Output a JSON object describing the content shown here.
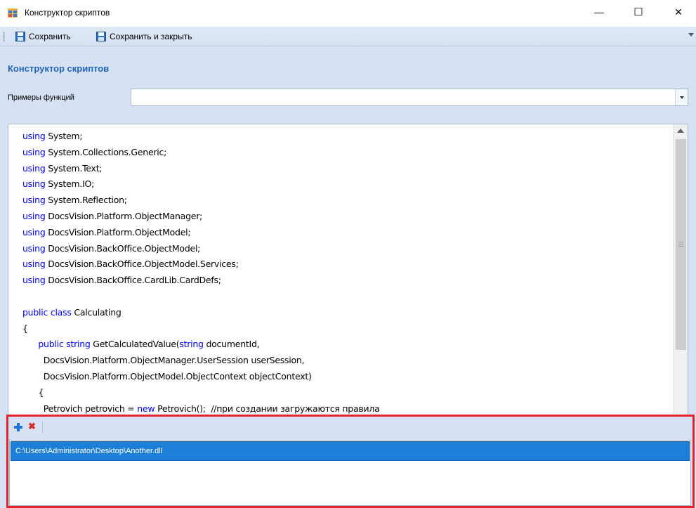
{
  "window": {
    "title": "Конструктор скриптов",
    "minimize_glyph": "—",
    "maximize_glyph": "☐",
    "close_glyph": "✕"
  },
  "toolbar": {
    "save_label": "Сохранить",
    "save_close_label": "Сохранить и закрыть"
  },
  "main": {
    "section_title": "Конструктор скриптов",
    "functions_label": "Примеры функций",
    "functions_selected": ""
  },
  "editor": {
    "lines": [
      [
        {
          "t": "using",
          "kw": true
        },
        {
          "t": " System;"
        }
      ],
      [
        {
          "t": "using",
          "kw": true
        },
        {
          "t": " System.Collections.Generic;"
        }
      ],
      [
        {
          "t": "using",
          "kw": true
        },
        {
          "t": " System.Text;"
        }
      ],
      [
        {
          "t": "using",
          "kw": true
        },
        {
          "t": " System.IO;"
        }
      ],
      [
        {
          "t": "using",
          "kw": true
        },
        {
          "t": " System.Reflection;"
        }
      ],
      [
        {
          "t": "using",
          "kw": true
        },
        {
          "t": " DocsVision.Platform.ObjectManager;"
        }
      ],
      [
        {
          "t": "using",
          "kw": true
        },
        {
          "t": " DocsVision.Platform.ObjectModel;"
        }
      ],
      [
        {
          "t": "using",
          "kw": true
        },
        {
          "t": " DocsVision.BackOffice.ObjectModel;"
        }
      ],
      [
        {
          "t": "using",
          "kw": true
        },
        {
          "t": " DocsVision.BackOffice.ObjectModel.Services;"
        }
      ],
      [
        {
          "t": "using",
          "kw": true
        },
        {
          "t": " DocsVision.BackOffice.CardLib.CardDefs;"
        }
      ],
      [
        {
          "t": ""
        }
      ],
      [
        {
          "t": "public class",
          "kw": true
        },
        {
          "t": " Calculating"
        }
      ],
      [
        {
          "t": "{"
        }
      ],
      [
        {
          "t": "      "
        },
        {
          "t": "public string",
          "kw": true
        },
        {
          "t": " GetCalculatedValue("
        },
        {
          "t": "string",
          "kw": true
        },
        {
          "t": " documentId,"
        }
      ],
      [
        {
          "t": "        DocsVision.Platform.ObjectManager.UserSession userSession,"
        }
      ],
      [
        {
          "t": "        DocsVision.Platform.ObjectModel.ObjectContext objectContext)"
        }
      ],
      [
        {
          "t": "      {"
        }
      ],
      [
        {
          "t": "        Petrovich petrovich = "
        },
        {
          "t": "new",
          "kw": true
        },
        {
          "t": " Petrovich();  //при создании загружаются правила"
        }
      ]
    ]
  },
  "libraries": {
    "items": [
      "C:\\Users\\Administrator\\Desktop\\Another.dll"
    ]
  },
  "colors": {
    "accent_title": "#1f64b8",
    "keyword": "#0000ff",
    "selection": "#1e7fd9",
    "highlight_border": "#e3232d",
    "panel_bg": "#d6e2f3"
  },
  "icons": {
    "app": "window-app-icon",
    "save": "floppy-disk-icon",
    "add": "plus-icon",
    "remove": "x-icon"
  }
}
